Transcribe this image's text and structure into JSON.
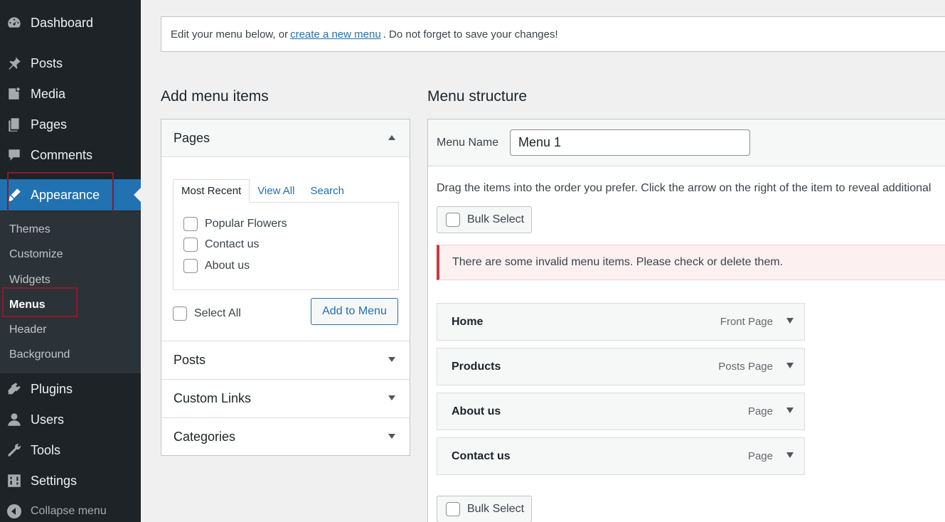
{
  "sidebar": {
    "items": [
      {
        "label": "Dashboard",
        "icon": "dashboard-icon"
      },
      {
        "label": "Posts",
        "icon": "pin-icon"
      },
      {
        "label": "Media",
        "icon": "media-icon"
      },
      {
        "label": "Pages",
        "icon": "pages-icon"
      },
      {
        "label": "Comments",
        "icon": "comment-icon"
      },
      {
        "label": "Appearance",
        "icon": "brush-icon"
      },
      {
        "label": "Plugins",
        "icon": "plugin-icon"
      },
      {
        "label": "Users",
        "icon": "user-icon"
      },
      {
        "label": "Tools",
        "icon": "wrench-icon"
      },
      {
        "label": "Settings",
        "icon": "settings-icon"
      }
    ],
    "submenu": [
      "Themes",
      "Customize",
      "Widgets",
      "Menus",
      "Header",
      "Background"
    ],
    "collapse_label": "Collapse menu"
  },
  "notice": {
    "before": "Edit your menu below, or",
    "link": "create a new menu",
    "after": ". Do not forget to save your changes!"
  },
  "add_items": {
    "heading": "Add menu items",
    "pages_title": "Pages",
    "tabs": [
      "Most Recent",
      "View All",
      "Search"
    ],
    "pages": [
      "Popular Flowers",
      "Contact us",
      "About us"
    ],
    "select_all": "Select All",
    "add_button": "Add to Menu",
    "sections": [
      "Posts",
      "Custom Links",
      "Categories"
    ]
  },
  "structure": {
    "heading": "Menu structure",
    "name_label": "Menu Name",
    "name_value": "Menu 1",
    "drag_text": "Drag the items into the order you prefer. Click the arrow on the right of the item to reveal additional",
    "bulk_select": "Bulk Select",
    "error": "There are some invalid menu items. Please check or delete them.",
    "items": [
      {
        "title": "Home",
        "type": "Front Page"
      },
      {
        "title": "Products",
        "type": "Posts Page"
      },
      {
        "title": "About us",
        "type": "Page"
      },
      {
        "title": "Contact us",
        "type": "Page"
      }
    ]
  },
  "colors": {
    "sidebar_bg": "#1d2327",
    "accent": "#2271b1",
    "error": "#d63638",
    "highlight": "#8b1a2b"
  }
}
